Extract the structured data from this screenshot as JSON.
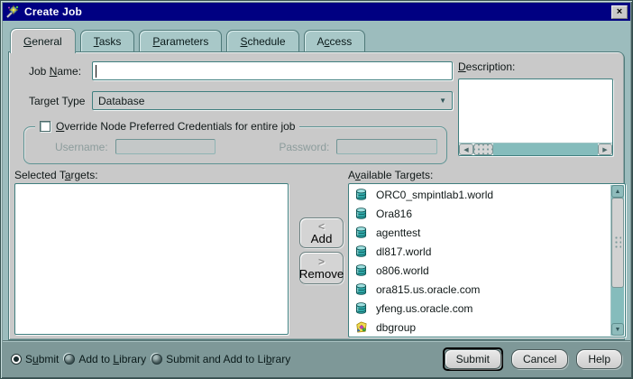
{
  "window": {
    "title": "Create Job",
    "close": "×"
  },
  "tabs": [
    {
      "pre": "",
      "key": "G",
      "post": "eneral",
      "active": true
    },
    {
      "pre": "",
      "key": "T",
      "post": "asks",
      "active": false
    },
    {
      "pre": "",
      "key": "P",
      "post": "arameters",
      "active": false
    },
    {
      "pre": "",
      "key": "S",
      "post": "chedule",
      "active": false
    },
    {
      "pre": "A",
      "key": "c",
      "post": "cess",
      "active": false
    }
  ],
  "fields": {
    "job_name": {
      "pre": "Job ",
      "key": "N",
      "post": "ame:",
      "value": ""
    },
    "target_type": {
      "label": "Target Type",
      "value": "Database"
    },
    "description": {
      "pre": "",
      "key": "D",
      "post": "escription:",
      "value": ""
    }
  },
  "credentials": {
    "checkbox": {
      "pre": "",
      "key": "O",
      "post": "verride Node Preferred Credentials for entire job",
      "checked": false
    },
    "username_label": "Username:",
    "username_value": "",
    "password_label": "Password:",
    "password_value": ""
  },
  "selected": {
    "pre": "Selected T",
    "key": "a",
    "post": "rgets:",
    "items": []
  },
  "available": {
    "pre": "A",
    "key": "v",
    "post": "ailable Targets:",
    "items": [
      {
        "name": "ORC0_smpintlab1.world",
        "icon": "database-icon"
      },
      {
        "name": "Ora816",
        "icon": "database-icon"
      },
      {
        "name": "agenttest",
        "icon": "database-icon"
      },
      {
        "name": "dl817.world",
        "icon": "database-icon"
      },
      {
        "name": "o806.world",
        "icon": "database-icon"
      },
      {
        "name": "ora815.us.oracle.com",
        "icon": "database-icon"
      },
      {
        "name": "yfeng.us.oracle.com",
        "icon": "database-icon"
      },
      {
        "name": "dbgroup",
        "icon": "group-icon"
      },
      {
        "name": "",
        "icon": "group-icon"
      }
    ]
  },
  "transfer": {
    "add": {
      "glyph": "<",
      "label": "Add"
    },
    "remove": {
      "glyph": ">",
      "label": "Remove"
    }
  },
  "radios": [
    {
      "pre": "S",
      "key": "u",
      "post": "bmit",
      "selected": true
    },
    {
      "pre": "Add to ",
      "key": "L",
      "post": "ibrary",
      "selected": false
    },
    {
      "pre": "Submit and Add to Li",
      "key": "b",
      "post": "rary",
      "selected": false
    }
  ],
  "actions": {
    "submit": "Submit",
    "cancel": "Cancel",
    "help": "Help"
  },
  "colors": {
    "titlebar": "#000082",
    "dialog_bg": "#7E9898",
    "tabstrip_bg": "#9CBCBD",
    "panel_bg": "#C9C9C9",
    "field_border": "#3F7F7F",
    "scrollbar": "#85BCBC"
  }
}
